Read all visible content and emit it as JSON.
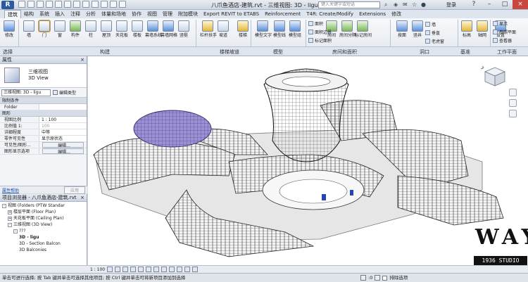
{
  "titlebar": {
    "logo": "R",
    "document_title": "八爪鱼酒店-建筑.rvt - 三维视图: 3D - ligu",
    "search_placeholder": "键入关键字或短语",
    "login": "登录"
  },
  "tabs": [
    "建筑",
    "结构",
    "系统",
    "插入",
    "注释",
    "分析",
    "体量和场地",
    "协作",
    "视图",
    "管理",
    "附加模块",
    "Export REVIT to ETABS",
    "Reinforcement",
    "T4R: Create/Modify",
    "Extensions",
    "修改"
  ],
  "ribbon": {
    "buttons": [
      "修改",
      "墙",
      "门",
      "窗",
      "构件",
      "柱",
      "屋顶",
      "天花板",
      "楼板",
      "幕墙系统",
      "幕墙网格",
      "竖梃",
      "栏杆扶手",
      "坡道",
      "楼梯",
      "模型文字",
      "模型线",
      "模型组",
      "房间",
      "房间分隔",
      "标记房间",
      "按面",
      "竖井",
      "墙",
      "垂直",
      "老虎窗",
      "标高",
      "轴网",
      "设置",
      "显示",
      "参照平面",
      "查看器"
    ],
    "small_items": [
      "面积",
      "面积边界",
      "标记面积",
      "面积",
      "显示",
      "参照平面",
      "查看器"
    ],
    "groups": [
      "选择",
      "构建",
      "楼梯坡道",
      "模型",
      "房间和面积",
      "洞口",
      "基准",
      "工作平面"
    ]
  },
  "properties": {
    "title": "属性",
    "type_name_line1": "三维视图",
    "type_name_line2": "3D View",
    "view_selector": "三维视图: 3D - ligu",
    "edit_type": "编辑类型",
    "sections": {
      "identity": "限制条件",
      "graphics": "图形"
    },
    "rows": [
      {
        "key": "Folder",
        "value": ""
      },
      {
        "key": "视图比例",
        "value": "1 : 100"
      },
      {
        "key": "比例值 1:",
        "value": "100"
      },
      {
        "key": "详细程度",
        "value": "中等"
      },
      {
        "key": "零件可见性",
        "value": "显示原状态"
      },
      {
        "key": "可见性/图形...",
        "value": "编辑..."
      },
      {
        "key": "图形显示选项",
        "value": "编辑..."
      }
    ],
    "help_link": "属性帮助",
    "apply": "应用"
  },
  "browser": {
    "title": "项目浏览器 - 八爪鱼酒店-建筑.rvt",
    "nodes": [
      {
        "text": "视图 (Folders (PTW Standar",
        "indent": 0,
        "toggle": "-",
        "bold": false
      },
      {
        "text": "楼层平面 (Floor Plan)",
        "indent": 1,
        "toggle": "+",
        "bold": false
      },
      {
        "text": "天花板平面 (Ceiling Plan)",
        "indent": 1,
        "toggle": "+",
        "bold": false
      },
      {
        "text": "三维视图 (3D View)",
        "indent": 1,
        "toggle": "-",
        "bold": false
      },
      {
        "text": "???",
        "indent": 2,
        "toggle": "-",
        "bold": false
      },
      {
        "text": "3D - ligu",
        "indent": 3,
        "toggle": "",
        "bold": true
      },
      {
        "text": "3D - Section Balcon",
        "indent": 3,
        "toggle": "",
        "bold": false
      },
      {
        "text": "3D Balconies",
        "indent": 3,
        "toggle": "",
        "bold": false
      }
    ]
  },
  "viewport": {
    "viewcube_label": "",
    "watermark_letters": "WAY",
    "watermark_sub": "1936 STUDIO"
  },
  "viewbar": {
    "scale": "1 : 100"
  },
  "status": {
    "text": "单击可进行选择; 按 Tab 键并单击可选择其他项目; 按 Ctrl 键并单击可将新项目添加到选择",
    "exclude_option": "排除选项",
    "coords": ":0"
  }
}
